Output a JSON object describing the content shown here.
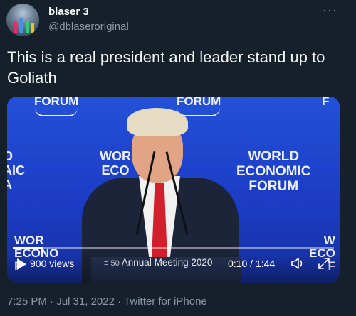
{
  "author": {
    "display_name": "blaser 3",
    "handle": "@dblaseroriginal"
  },
  "more_menu": "···",
  "tweet_text": "This is a real president and leader stand up to Goliath",
  "media": {
    "logos": {
      "top_left": "FORUM",
      "top_center": "FORUM",
      "top_right": "F",
      "left_mid": "O\nAIC\nA",
      "center": "WOR\nECO",
      "right_big": "WORLD\nECONOMIC\nFORUM",
      "bottom_left": "WOR\nECONO\nF",
      "bottom_right": "W\nECO\nF"
    },
    "banner": "Annual Meeting 2020",
    "views": "900 views",
    "time": "0:10 / 1:44",
    "progress": 0.096
  },
  "meta": {
    "time": "7:25 PM",
    "separator": "·",
    "date": "Jul 31, 2022",
    "client": "Twitter for iPhone"
  },
  "colors": {
    "background": "#15202b",
    "text": "#f7f9f9",
    "muted": "#8b98a5",
    "video_bg": "#1e3fbf"
  }
}
